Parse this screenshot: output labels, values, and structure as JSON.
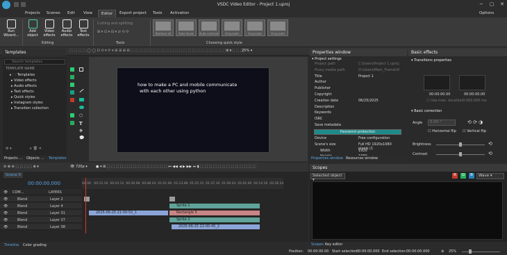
{
  "window": {
    "title": "VSDC Video Editor - Project 1.uproj",
    "options_label": "Options"
  },
  "menu": {
    "items": [
      "Projects",
      "Scenes",
      "Edit",
      "View",
      "Editor",
      "Export project",
      "Tools",
      "Activation"
    ],
    "active": "Editor"
  },
  "ribbon": {
    "buttons": [
      {
        "label": "Run Wizard...",
        "icon": "wand-icon"
      },
      {
        "label": "Add object",
        "icon": "add-object-icon"
      },
      {
        "label": "Video effects",
        "icon": "video-effects-icon"
      },
      {
        "label": "Audio effects",
        "icon": "audio-effects-icon"
      },
      {
        "label": "Text effects",
        "icon": "text-effects-icon"
      }
    ],
    "cutting_label": "Cutting and splitting",
    "groups": {
      "editing": "Editing",
      "tools": "Tools",
      "quick_style": "Choosing quick style"
    },
    "styles": [
      "Remove all",
      "Auto levels",
      "Auto contrast",
      "Grayscale",
      "Grayscale",
      "Grayscale"
    ]
  },
  "templates": {
    "header": "Templates",
    "search_placeholder": "Search templates",
    "column": "TEMPLATE NAME",
    "items": [
      "Templates",
      "Video effects",
      "Audio effects",
      "Text effects",
      "Quick styles",
      "Instagram styles",
      "Transition collection"
    ],
    "tabs": [
      "Projects ...",
      "Objects ...",
      "Templates"
    ]
  },
  "preview": {
    "zoom": "25%",
    "text_line1": "how to make a PC and mobile communicate",
    "text_line2": "with each other using python",
    "quality": "720p"
  },
  "properties": {
    "header": "Properties window",
    "section": "Project settings",
    "rows": [
      {
        "k": "Project path",
        "v": "C:\\Users\\Project 1.uproj"
      },
      {
        "k": "Proxy media path",
        "v": "D:\\Users\\Main_Frame\\Vi"
      },
      {
        "k": "Title",
        "v": "Project 1"
      },
      {
        "k": "Author",
        "v": ""
      },
      {
        "k": "Publisher",
        "v": ""
      },
      {
        "k": "Copyright",
        "v": ""
      },
      {
        "k": "Creation date",
        "v": "06/25/2025"
      },
      {
        "k": "Description",
        "v": ""
      },
      {
        "k": "Keywords",
        "v": ""
      },
      {
        "k": "ISRC",
        "v": ""
      },
      {
        "k": "Save metadata",
        "v": ""
      }
    ],
    "password_btn": "Password protection",
    "rows2": [
      {
        "k": "Device",
        "v": "Free configuration"
      },
      {
        "k": "Scene's size",
        "v": "Full HD 1920x1080 pixels (1"
      },
      {
        "k": "Width",
        "v": "1920"
      },
      {
        "k": "Height",
        "v": "1080"
      }
    ],
    "tabs": [
      "Properties window",
      "Resources window"
    ]
  },
  "basic": {
    "header": "Basic effects",
    "transitions": "Transitions properties",
    "t1": "00:00:00.00",
    "t2": "00:00:00.00",
    "use_max": "Use max. duration",
    "t3": "0:000.000 ms",
    "correction": "Basic correction",
    "angle_label": "Angle",
    "angle_value": "0.00 °",
    "hflip": "Horizontal flip",
    "vflip": "Vertical flip",
    "brightness": "Brightness",
    "contrast": "Contrast"
  },
  "timeline": {
    "scene": "Scene 0",
    "time": "00:00:00.000",
    "com_label": "COM...",
    "layers_label": "LAYERS",
    "ticks": [
      "00:00",
      "00:12.16",
      "00:24.12",
      "00:36.08",
      "00:48.24",
      "01:01.00",
      "01:13.08",
      "01:25.12",
      "01:37.16",
      "01:49.24",
      "02:02.00",
      "02:14.16",
      "02:26.24"
    ],
    "tracks": [
      {
        "blend": "Blend",
        "name": "Layer 2"
      },
      {
        "blend": "Blend",
        "name": "Layer 4"
      },
      {
        "blend": "Blend",
        "name": "Layer 31"
      },
      {
        "blend": "Blend",
        "name": "Layer 37"
      },
      {
        "blend": "Blend",
        "name": "Layer 38"
      }
    ],
    "clips": {
      "c1": "Sprite 1",
      "c2": "2025-06-25 21-50-52_1",
      "c3": "Rectangle 5",
      "c4": "Sprite 2",
      "c5": "2025-06-25 22-00-45_2"
    },
    "tabs": [
      "Timeline",
      "Color grading"
    ]
  },
  "scopes": {
    "header": "Scopes",
    "selected": "Selected object",
    "mode": "Wave",
    "r": "R",
    "g": "G",
    "b": "B",
    "tabs": [
      "Scopes",
      "Key editor"
    ]
  },
  "status": {
    "position_label": "Position:",
    "position": "00:00:00.00",
    "start_label": "Start selection:",
    "start": "00:00:00.000",
    "end_label": "End selection:",
    "end": "00:00:00.000",
    "zoom": "25%"
  }
}
